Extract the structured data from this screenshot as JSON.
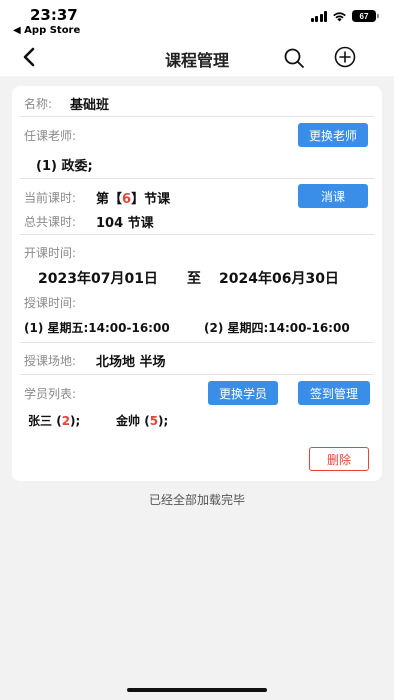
{
  "status_bar": {
    "time": "23:37",
    "back_app": "◀ App Store",
    "battery": "67"
  },
  "nav": {
    "title": "课程管理",
    "icons": [
      "back-chevron-icon",
      "search-icon",
      "add-circle-icon"
    ]
  },
  "course": {
    "name_label": "名称:",
    "name_value": "基础班",
    "teacher_label": "任课老师:",
    "change_teacher_button": "更换老师",
    "teacher_value": "(1) 政委;",
    "current_hours_label": "当前课时:",
    "current_hours_prefix": "第【",
    "current_hours_number": "6",
    "current_hours_suffix": "】节课",
    "cancel_class_button": "消课",
    "total_hours_label": "总共课时:",
    "total_hours_value": "104 节课",
    "start_time_label": "开课时间:",
    "start_date": "2023年07月01日",
    "date_separator": "至",
    "end_date": "2024年06月30日",
    "class_time_label": "授课时间:",
    "class_time_1": "(1) 星期五:14:00-16:00",
    "class_time_2": "(2) 星期四:14:00-16:00",
    "venue_label": "授课场地:",
    "venue_value": "北场地 半场",
    "students_label": "学员列表:",
    "change_students_button": "更换学员",
    "attendance_button": "签到管理",
    "students": [
      {
        "name": "张三",
        "count": "2"
      },
      {
        "name": "金帅",
        "count": "5"
      }
    ],
    "delete_button": "删除"
  },
  "footer": {
    "loaded_text": "已经全部加载完毕"
  },
  "colors": {
    "accent_blue": "#3a8ee8",
    "danger_red": "#e8433a"
  }
}
